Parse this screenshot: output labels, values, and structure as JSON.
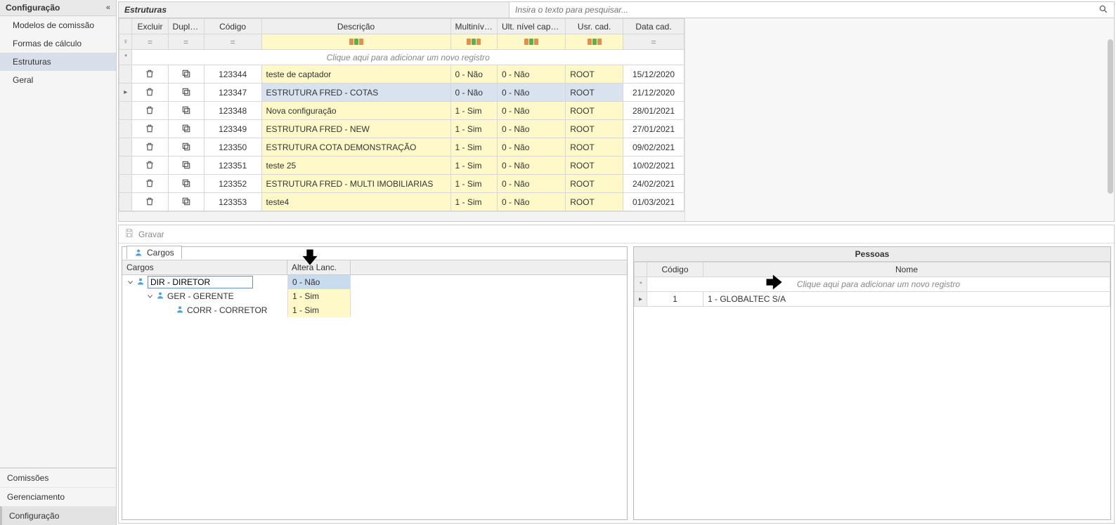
{
  "sidebar": {
    "head": "Configuração",
    "collapseGlyph": "«",
    "items": [
      {
        "label": "Modelos de comissão",
        "active": false
      },
      {
        "label": "Formas de cálculo",
        "active": false
      },
      {
        "label": "Estruturas",
        "active": true
      },
      {
        "label": "Geral",
        "active": false
      }
    ],
    "bottom": [
      {
        "label": "Comissões",
        "active": false
      },
      {
        "label": "Gerenciamento",
        "active": false
      },
      {
        "label": "Configuração",
        "active": true
      }
    ]
  },
  "top": {
    "title": "Estruturas",
    "searchPlaceholder": "Insira o texto para pesquisar...",
    "newRowText": "Clique aqui para adicionar um novo registro",
    "columns": {
      "excluir": "Excluir",
      "duplicar": "Duplicar",
      "codigo": "Código",
      "descricao": "Descrição",
      "multiniveis": "Multiníveis",
      "ultnivel": "Ult. nível captador",
      "usrcad": "Usr. cad.",
      "datacad": "Data cad."
    },
    "filterEq": "=",
    "rows": [
      {
        "codigo": "123344",
        "desc": "teste de captador",
        "multi": "0 - Não",
        "ult": "0 - Não",
        "usr": "ROOT",
        "data": "15/12/2020",
        "sel": false
      },
      {
        "codigo": "123347",
        "desc": "ESTRUTURA FRED - COTAS",
        "multi": "0 - Não",
        "ult": "0 - Não",
        "usr": "ROOT",
        "data": "21/12/2020",
        "sel": true
      },
      {
        "codigo": "123348",
        "desc": "Nova configuração",
        "multi": "1 - Sim",
        "ult": "0 - Não",
        "usr": "ROOT",
        "data": "28/01/2021",
        "sel": false
      },
      {
        "codigo": "123349",
        "desc": "ESTRUTURA FRED - NEW",
        "multi": "1 - Sim",
        "ult": "0 - Não",
        "usr": "ROOT",
        "data": "27/01/2021",
        "sel": false
      },
      {
        "codigo": "123350",
        "desc": "ESTRUTURA COTA DEMONSTRAÇÃO",
        "multi": "1 - Sim",
        "ult": "0 - Não",
        "usr": "ROOT",
        "data": "09/02/2021",
        "sel": false
      },
      {
        "codigo": "123351",
        "desc": "teste 25",
        "multi": "1 - Sim",
        "ult": "0 - Não",
        "usr": "ROOT",
        "data": "10/02/2021",
        "sel": false
      },
      {
        "codigo": "123352",
        "desc": "ESTRUTURA FRED - MULTI IMOBILIARIAS",
        "multi": "1 - Sim",
        "ult": "0 - Não",
        "usr": "ROOT",
        "data": "24/02/2021",
        "sel": false
      },
      {
        "codigo": "123353",
        "desc": "teste4",
        "multi": "1 - Sim",
        "ult": "0 - Não",
        "usr": "ROOT",
        "data": "01/03/2021",
        "sel": false
      }
    ]
  },
  "bottom": {
    "gravar": "Gravar",
    "cargos": {
      "tab": "Cargos",
      "col_cargos": "Cargos",
      "col_altera": "Altera Lanc.",
      "rows": [
        {
          "label": "DIR - DIRETOR",
          "alt": "0 - Não",
          "level": 0,
          "sel": true,
          "expand": true
        },
        {
          "label": "GER - GERENTE",
          "alt": "1 - Sim",
          "level": 1,
          "sel": false,
          "expand": true
        },
        {
          "label": "CORR - CORRETOR",
          "alt": "1 - Sim",
          "level": 2,
          "sel": false,
          "expand": false
        }
      ]
    },
    "pessoas": {
      "title": "Pessoas",
      "col_codigo": "Código",
      "col_nome": "Nome",
      "newRowText": "Clique aqui para adicionar um novo registro",
      "rows": [
        {
          "codigo": "1",
          "nome": "1 - GLOBALTEC S/A"
        }
      ]
    }
  }
}
